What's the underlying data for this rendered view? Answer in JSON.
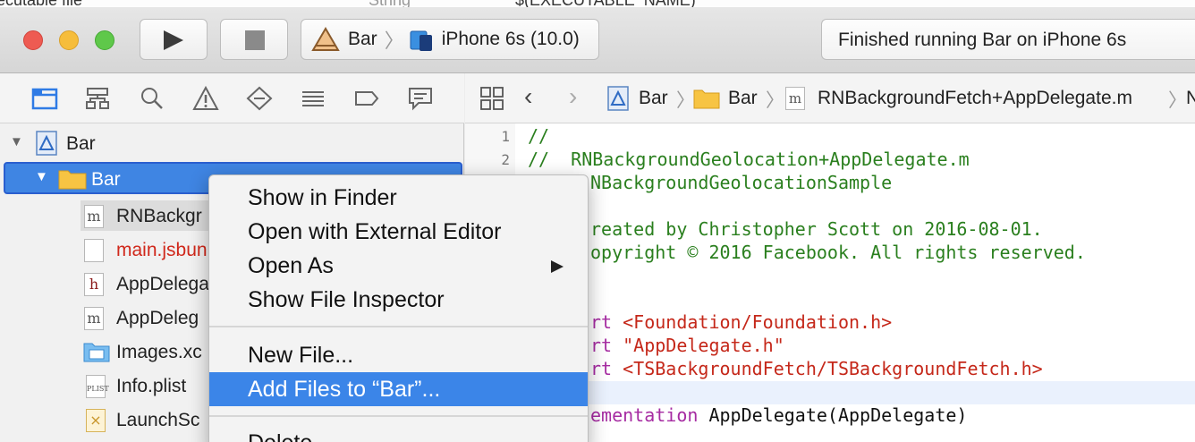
{
  "top_strip": {
    "left_text": "ecutable file",
    "mid_text": "String",
    "right_text": "$(EXECUTABLE_NAME)"
  },
  "toolbar": {
    "scheme": "Bar",
    "device": "iPhone 6s (10.0)",
    "status": "Finished running Bar on iPhone 6s"
  },
  "navigator": {
    "project": "Bar",
    "group": "Bar",
    "files": [
      {
        "name": "RNBackgr",
        "type": "m",
        "color": "#222222"
      },
      {
        "name": "main.jsbun",
        "type": "js",
        "color": "#d0281b"
      },
      {
        "name": "AppDelega",
        "type": "h",
        "color": "#222222"
      },
      {
        "name": "AppDeleg",
        "type": "m",
        "color": "#222222"
      },
      {
        "name": "Images.xc",
        "type": "assets",
        "color": "#222222"
      },
      {
        "name": "Info.plist",
        "type": "plist",
        "color": "#222222"
      },
      {
        "name": "LaunchSc",
        "type": "xib",
        "color": "#222222"
      }
    ]
  },
  "jumpbar": {
    "crumbs": [
      "Bar",
      "Bar",
      "RNBackgroundFetch+AppDelegate.m"
    ],
    "overflow": "N"
  },
  "editor": {
    "line_numbers": [
      "1",
      "2"
    ],
    "lines": [
      {
        "text": "//",
        "kind": "comment"
      },
      {
        "text": "//  RNBackgroundGeolocation+AppDelegate.m",
        "kind": "comment"
      },
      {
        "text": "NBackgroundGeolocationSample",
        "kind": "comment"
      },
      {
        "text": "",
        "kind": "plain"
      },
      {
        "text": "reated by Christopher Scott on 2016-08-01.",
        "kind": "comment"
      },
      {
        "text": "opyright © 2016 Facebook. All rights reserved.",
        "kind": "comment"
      },
      {
        "text": "",
        "kind": "plain"
      },
      {
        "text": "",
        "kind": "plain"
      },
      {
        "text_kw": "rt ",
        "text_str": "<Foundation/Foundation.h>",
        "kind": "import"
      },
      {
        "text_kw": "rt ",
        "text_str": "\"AppDelegate.h\"",
        "kind": "import"
      },
      {
        "text_kw": "rt ",
        "text_str": "<TSBackgroundFetch/TSBackgroundFetch.h>",
        "kind": "import"
      },
      {
        "text": "",
        "kind": "plain"
      },
      {
        "text_kw": "ementation ",
        "text_plain": "AppDelegate(AppDelegate)",
        "kind": "impl"
      }
    ]
  },
  "context_menu": {
    "items": [
      {
        "label": "Show in Finder"
      },
      {
        "label": "Open with External Editor"
      },
      {
        "label": "Open As",
        "submenu": true
      },
      {
        "label": "Show File Inspector"
      },
      {
        "label": "New File..."
      },
      {
        "label": "Add Files to “Bar”...",
        "highlighted": true
      },
      {
        "label": "Delete"
      }
    ]
  }
}
